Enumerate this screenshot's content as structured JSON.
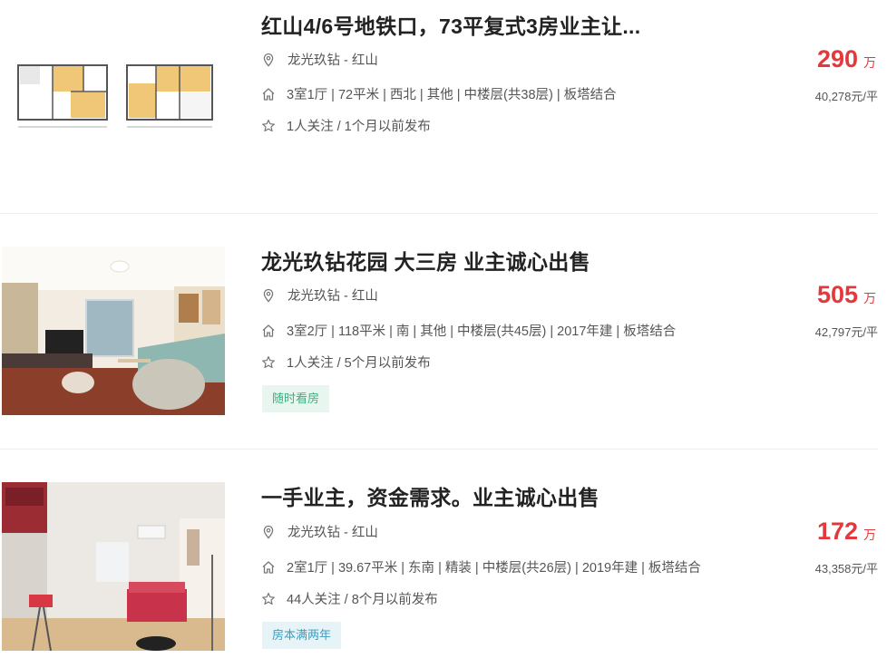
{
  "listings": [
    {
      "title": "红山4/6号地铁口，73平复式3房业主让...",
      "location": "龙光玖钻 - 红山",
      "details": "3室1厅 | 72平米 | 西北 | 其他 | 中楼层(共38层) | 板塔结合",
      "follow": "1人关注 / 1个月以前发布",
      "price": "290",
      "price_unit": "万",
      "unit_price": "40,278元/平",
      "tag": "",
      "image": "floorplan-image"
    },
    {
      "title": "龙光玖钻花园 大三房 业主诚心出售",
      "location": "龙光玖钻 - 红山",
      "details": "3室2厅 | 118平米 | 南 | 其他 | 中楼层(共45层) | 2017年建 | 板塔结合",
      "follow": "1人关注 / 5个月以前发布",
      "price": "505",
      "price_unit": "万",
      "unit_price": "42,797元/平",
      "tag": "随时看房",
      "image": "living-room-photo"
    },
    {
      "title": "一手业主，资金需求。业主诚心出售",
      "location": "龙光玖钻 - 红山",
      "details": "2室1厅 | 39.67平米 | 东南 | 精装 | 中楼层(共26层) | 2019年建 | 板塔结合",
      "follow": "44人关注 / 8个月以前发布",
      "price": "172",
      "price_unit": "万",
      "unit_price": "43,358元/平",
      "tag": "房本满两年",
      "image": "apartment-photo"
    }
  ],
  "icons": {
    "location": "location-pin-icon",
    "house": "house-icon",
    "follow": "star-icon"
  },
  "colors": {
    "price": "#e4393c",
    "tag_green_bg": "#e9f5ef",
    "tag_green_text": "#3db07f",
    "tag_blue_bg": "#e6f4f8",
    "tag_blue_text": "#3a9ec2"
  }
}
